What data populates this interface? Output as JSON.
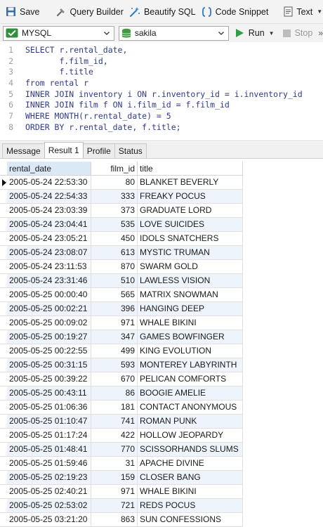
{
  "toolbar": {
    "save": "Save",
    "query_builder": "Query Builder",
    "beautify": "Beautify SQL",
    "code_snippet": "Code Snippet",
    "text": "Text"
  },
  "connection": {
    "server": "MYSQL",
    "database": "sakila",
    "run": "Run",
    "stop": "Stop"
  },
  "editor": {
    "lines": [
      {
        "num": "1",
        "text": "SELECT r.rental_date,"
      },
      {
        "num": "2",
        "text": "       f.film_id,"
      },
      {
        "num": "3",
        "text": "       f.title"
      },
      {
        "num": "4",
        "text": "from rental r"
      },
      {
        "num": "5",
        "text": "INNER JOIN inventory i ON r.inventory_id = i.inventory_id"
      },
      {
        "num": "6",
        "text": "INNER JOIN film f ON i.film_id = f.film_id"
      },
      {
        "num": "7",
        "text": "WHERE MONTH(r.rental_date) = 5"
      },
      {
        "num": "8",
        "text": "ORDER BY r.rental_date, f.title;"
      }
    ]
  },
  "tabs": [
    "Message",
    "Result 1",
    "Profile",
    "Status"
  ],
  "grid": {
    "columns": [
      "rental_date",
      "film_id",
      "title"
    ],
    "rows": [
      [
        "2005-05-24 22:53:30",
        "80",
        "BLANKET BEVERLY"
      ],
      [
        "2005-05-24 22:54:33",
        "333",
        "FREAKY POCUS"
      ],
      [
        "2005-05-24 23:03:39",
        "373",
        "GRADUATE LORD"
      ],
      [
        "2005-05-24 23:04:41",
        "535",
        "LOVE SUICIDES"
      ],
      [
        "2005-05-24 23:05:21",
        "450",
        "IDOLS SNATCHERS"
      ],
      [
        "2005-05-24 23:08:07",
        "613",
        "MYSTIC TRUMAN"
      ],
      [
        "2005-05-24 23:11:53",
        "870",
        "SWARM GOLD"
      ],
      [
        "2005-05-24 23:31:46",
        "510",
        "LAWLESS VISION"
      ],
      [
        "2005-05-25 00:00:40",
        "565",
        "MATRIX SNOWMAN"
      ],
      [
        "2005-05-25 00:02:21",
        "396",
        "HANGING DEEP"
      ],
      [
        "2005-05-25 00:09:02",
        "971",
        "WHALE BIKINI"
      ],
      [
        "2005-05-25 00:19:27",
        "347",
        "GAMES BOWFINGER"
      ],
      [
        "2005-05-25 00:22:55",
        "499",
        "KING EVOLUTION"
      ],
      [
        "2005-05-25 00:31:15",
        "593",
        "MONTEREY LABYRINTH"
      ],
      [
        "2005-05-25 00:39:22",
        "670",
        "PELICAN COMFORTS"
      ],
      [
        "2005-05-25 00:43:11",
        "86",
        "BOOGIE AMELIE"
      ],
      [
        "2005-05-25 01:06:36",
        "181",
        "CONTACT ANONYMOUS"
      ],
      [
        "2005-05-25 01:10:47",
        "741",
        "ROMAN PUNK"
      ],
      [
        "2005-05-25 01:17:24",
        "422",
        "HOLLOW JEOPARDY"
      ],
      [
        "2005-05-25 01:48:41",
        "770",
        "SCISSORHANDS SLUMS"
      ],
      [
        "2005-05-25 01:59:46",
        "31",
        "APACHE DIVINE"
      ],
      [
        "2005-05-25 02:19:23",
        "159",
        "CLOSER BANG"
      ],
      [
        "2005-05-25 02:40:21",
        "971",
        "WHALE BIKINI"
      ],
      [
        "2005-05-25 02:53:02",
        "721",
        "REDS POCUS"
      ],
      [
        "2005-05-25 03:21:20",
        "863",
        "SUN CONFESSIONS"
      ]
    ]
  },
  "colors": {
    "keyword": "#2e3a8c",
    "row_alt": "#eef4fb",
    "run_green": "#2ea043",
    "db_green": "#3f9b3f"
  }
}
